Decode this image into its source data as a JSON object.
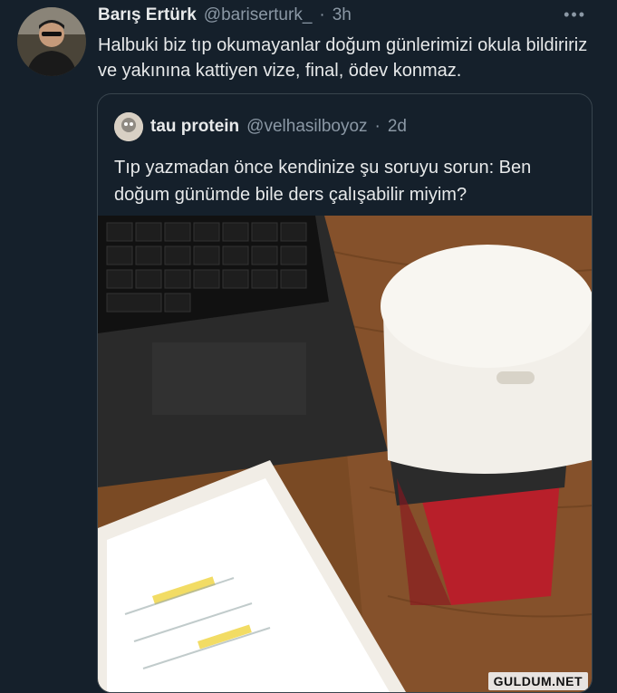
{
  "tweet": {
    "author_name": "Barış Ertürk",
    "author_handle": "@bariserturk_",
    "separator": "·",
    "time": "3h",
    "more": "•••",
    "text": "Halbuki biz tıp okumayanlar doğum günlerimizi okula bildiririz ve yakınına kattiyen vize, final, ödev konmaz."
  },
  "quoted_tweet": {
    "author_name": "tau protein",
    "author_handle": "@velhasilboyoz",
    "separator": "·",
    "time": "2d",
    "text": "Tıp yazmadan önce kendinize şu soruyu sorun: Ben doğum günümde bile ders çalışabilir miyim?"
  },
  "watermark": "GULDUM.NET",
  "colors": {
    "background": "#15202b",
    "text": "#e7e9ea",
    "muted": "#8b98a5",
    "border": "#38444d"
  }
}
